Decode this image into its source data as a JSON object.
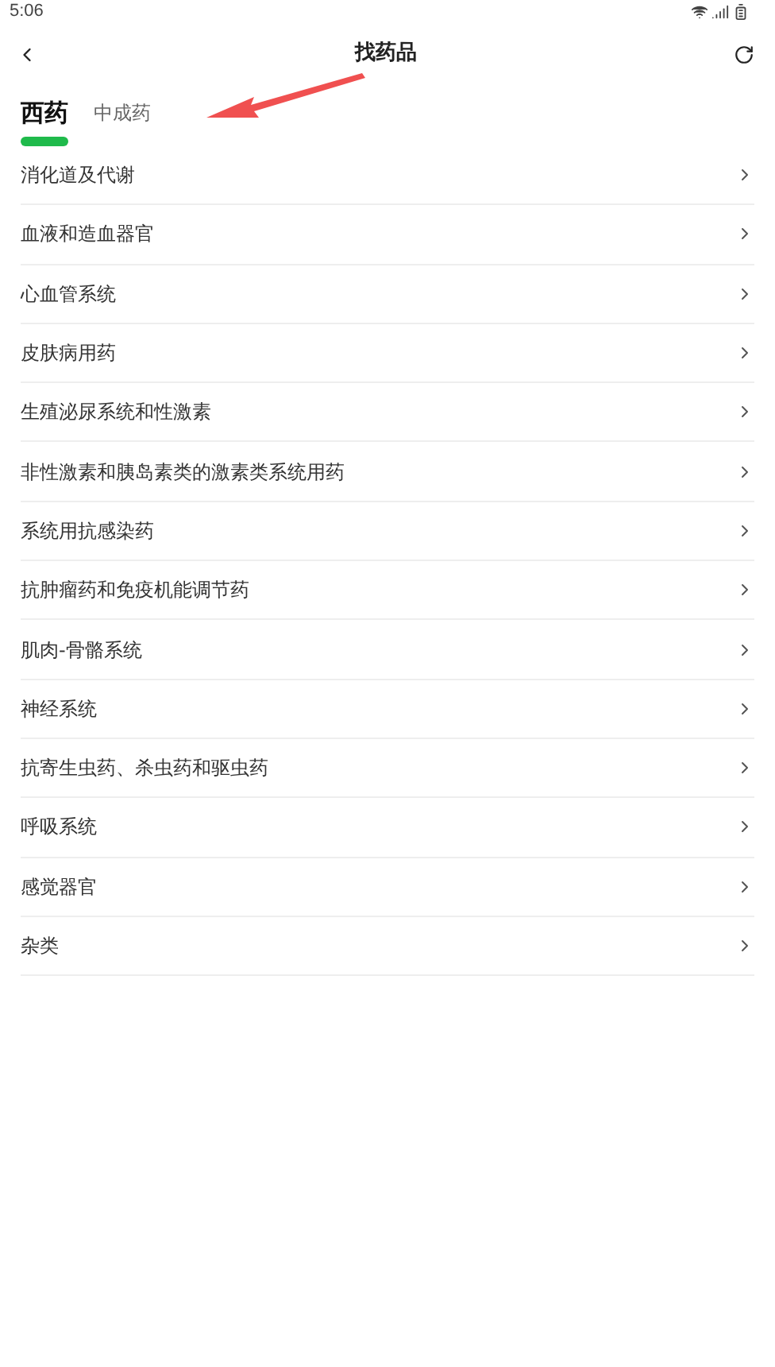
{
  "status_bar": {
    "time": "5:06"
  },
  "header": {
    "title": "找药品"
  },
  "tabs": [
    {
      "label": "西药",
      "selected": true
    },
    {
      "label": "中成药",
      "selected": false
    }
  ],
  "categories": [
    {
      "label": "消化道及代谢"
    },
    {
      "label": "血液和造血器官"
    },
    {
      "label": "心血管系统"
    },
    {
      "label": "皮肤病用药"
    },
    {
      "label": "生殖泌尿系统和性激素"
    },
    {
      "label": "非性激素和胰岛素类的激素类系统用药"
    },
    {
      "label": "系统用抗感染药"
    },
    {
      "label": "抗肿瘤药和免疫机能调节药"
    },
    {
      "label": "肌肉-骨骼系统"
    },
    {
      "label": "神经系统"
    },
    {
      "label": "抗寄生虫药、杀虫药和驱虫药"
    },
    {
      "label": "呼吸系统"
    },
    {
      "label": "感觉器官"
    },
    {
      "label": "杂类"
    }
  ]
}
